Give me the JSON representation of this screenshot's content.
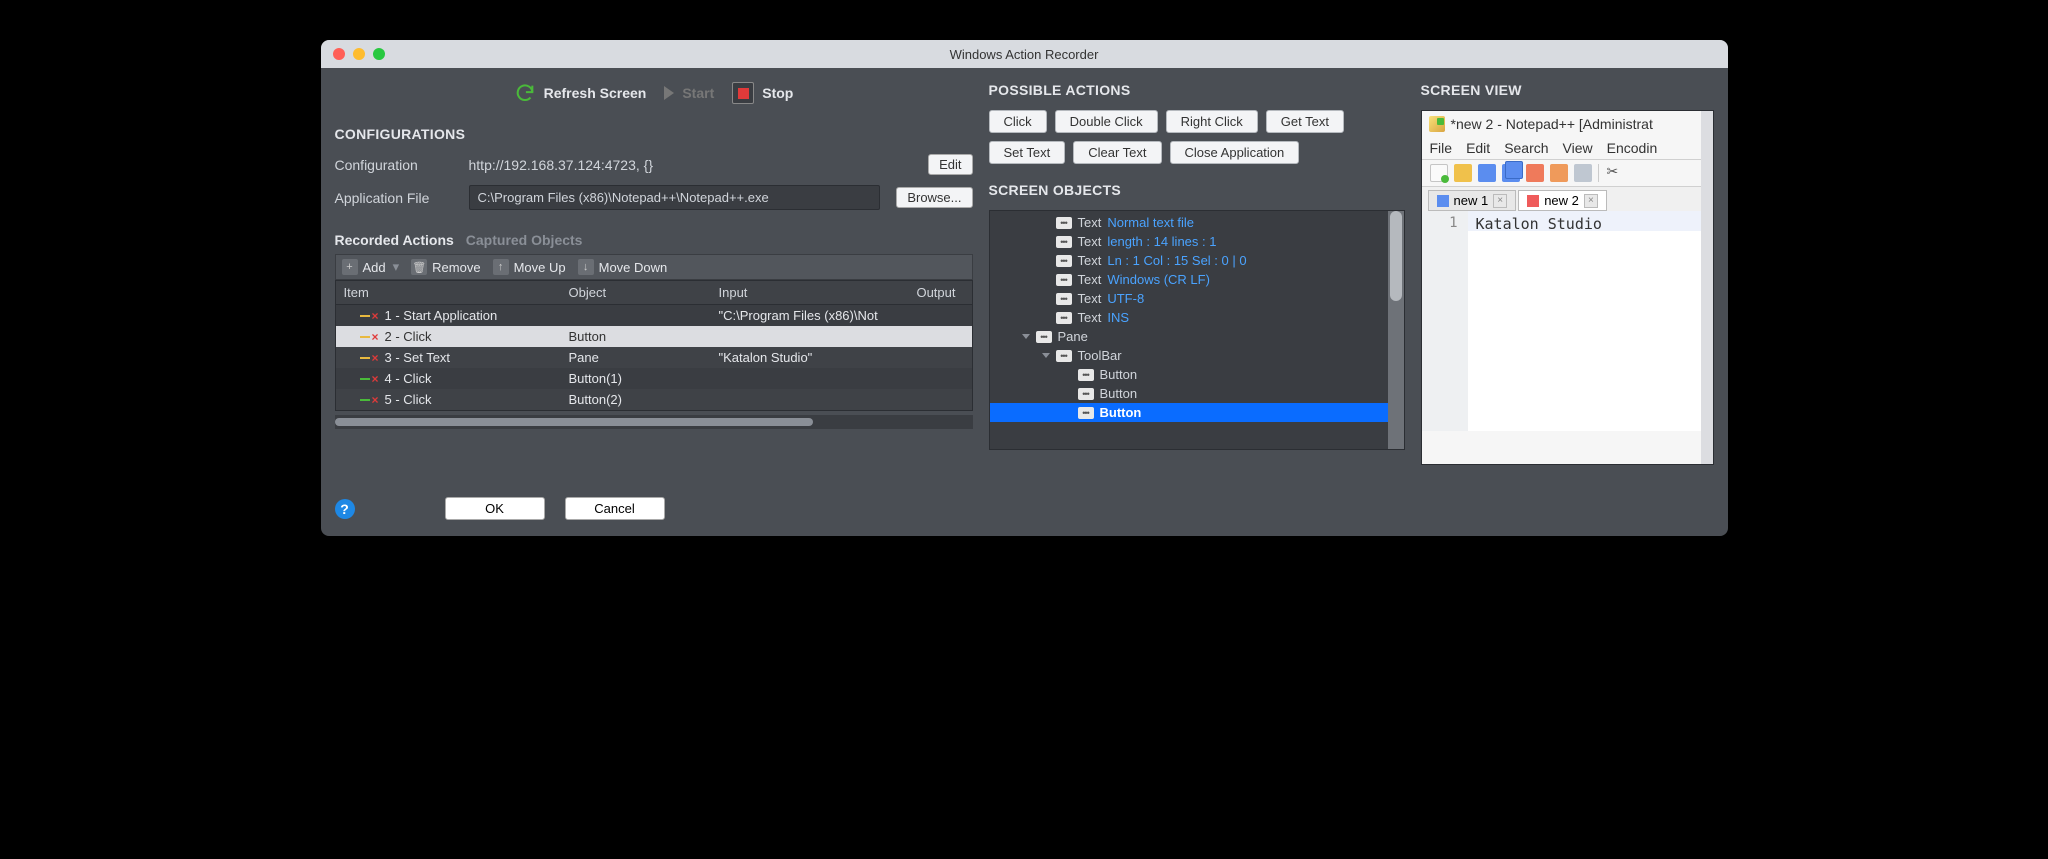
{
  "window": {
    "title": "Windows Action Recorder"
  },
  "toolbar": {
    "refresh_label": "Refresh Screen",
    "start_label": "Start",
    "stop_label": "Stop"
  },
  "configurations": {
    "heading": "CONFIGURATIONS",
    "config_label": "Configuration",
    "config_value": "http://192.168.37.124:4723, {}",
    "edit_label": "Edit",
    "appfile_label": "Application File",
    "appfile_value": "C:\\Program Files (x86)\\Notepad++\\Notepad++.exe",
    "browse_label": "Browse..."
  },
  "tabs": {
    "recorded": "Recorded Actions",
    "captured": "Captured Objects"
  },
  "tab_toolbar": {
    "add": "Add",
    "remove": "Remove",
    "moveup": "Move Up",
    "movedown": "Move Down"
  },
  "table": {
    "headers": {
      "c1": "Item",
      "c2": "Object",
      "c3": "Input",
      "c4": "Output"
    },
    "rows": [
      {
        "item": "1 - Start Application",
        "object": "",
        "input": "\"C:\\Program Files (x86)\\Not",
        "output": ""
      },
      {
        "item": "2 - Click",
        "object": "Button",
        "input": "",
        "output": ""
      },
      {
        "item": "3 - Set Text",
        "object": "Pane",
        "input": "\"Katalon Studio\"",
        "output": ""
      },
      {
        "item": "4 - Click",
        "object": "Button(1)",
        "input": "",
        "output": ""
      },
      {
        "item": "5 - Click",
        "object": "Button(2)",
        "input": "",
        "output": ""
      }
    ]
  },
  "bottom": {
    "ok": "OK",
    "cancel": "Cancel"
  },
  "possible_actions": {
    "heading": "POSSIBLE ACTIONS",
    "buttons": [
      "Click",
      "Double Click",
      "Right Click",
      "Get Text",
      "Set Text",
      "Clear Text",
      "Close Application"
    ]
  },
  "screen_objects": {
    "heading": "SCREEN OBJECTS",
    "nodes": [
      {
        "indent": 60,
        "type": "Text",
        "meta": "Normal text file"
      },
      {
        "indent": 60,
        "type": "Text",
        "meta": "length : 14    lines : 1"
      },
      {
        "indent": 60,
        "type": "Text",
        "meta": "Ln : 1    Col : 15    Sel : 0 | 0"
      },
      {
        "indent": 60,
        "type": "Text",
        "meta": "Windows (CR LF)"
      },
      {
        "indent": 60,
        "type": "Text",
        "meta": "UTF-8"
      },
      {
        "indent": 60,
        "type": "Text",
        "meta": "INS"
      },
      {
        "indent": 26,
        "type": "Pane",
        "caret": true
      },
      {
        "indent": 46,
        "type": "ToolBar",
        "caret": true
      },
      {
        "indent": 82,
        "type": "Button"
      },
      {
        "indent": 82,
        "type": "Button"
      },
      {
        "indent": 82,
        "type": "Button",
        "selected": true
      }
    ]
  },
  "screen_view": {
    "heading": "SCREEN VIEW",
    "np_title": "*new 2 - Notepad++ [Administrat",
    "menu": [
      "File",
      "Edit",
      "Search",
      "View",
      "Encodin"
    ],
    "tabs": [
      {
        "label": "new 1",
        "active": false,
        "icon": "blue"
      },
      {
        "label": "new 2",
        "active": true,
        "icon": "red"
      }
    ],
    "line_no": "1",
    "editor_text": "Katalon Studio"
  }
}
